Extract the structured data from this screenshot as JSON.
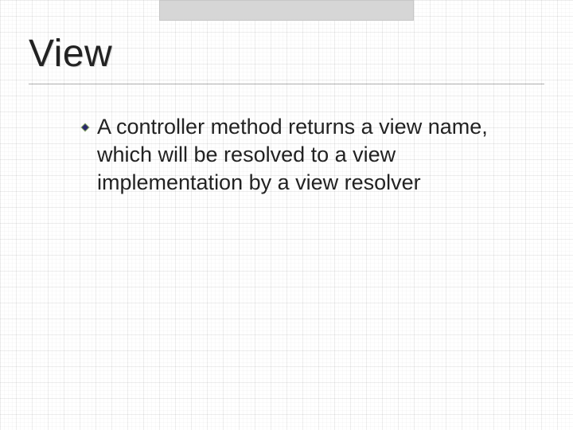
{
  "slide": {
    "title": "View",
    "bullets": [
      {
        "text": "A controller method returns a view name, which will be resolved to a view implementation by a view resolver"
      }
    ]
  },
  "icons": {
    "bullet": "diamond-icon"
  },
  "colors": {
    "bullet_fill": "#2a2a6a",
    "text": "#222222",
    "topbar": "#d6d6d6"
  }
}
